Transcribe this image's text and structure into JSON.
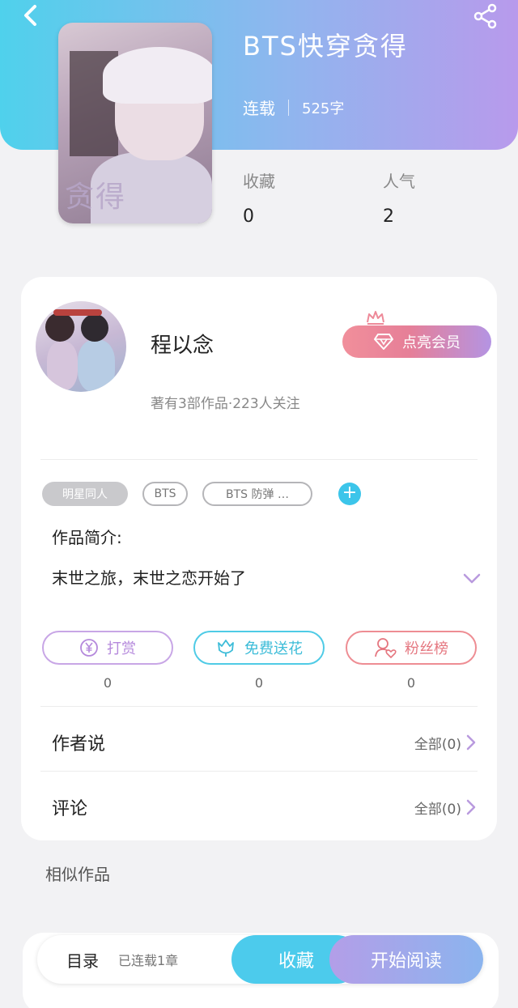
{
  "book": {
    "title": "BTS快穿贪得",
    "status": "连载",
    "words": "525字",
    "cover_text": "贪得",
    "stats": {
      "favorites_label": "收藏",
      "favorites_value": "0",
      "popularity_label": "人气",
      "popularity_value": "2"
    }
  },
  "author": {
    "name": "程以念",
    "meta": "著有3部作品·223人关注",
    "vip_label": "点亮会员"
  },
  "tags": [
    "明星同人",
    "BTS",
    "BTS 防弹 …"
  ],
  "intro": {
    "title": "作品简介:",
    "text": "末世之旅，末世之恋开始了"
  },
  "actions": [
    {
      "label": "打赏",
      "count": "0",
      "icon": "yen-coin-icon"
    },
    {
      "label": "免费送花",
      "count": "0",
      "icon": "flower-icon"
    },
    {
      "label": "粉丝榜",
      "count": "0",
      "icon": "fan-user-icon"
    }
  ],
  "author_say": {
    "label": "作者说",
    "more": "全部(0)"
  },
  "comments": {
    "label": "评论",
    "more": "全部(0)"
  },
  "similar": {
    "title": "相似作品"
  },
  "bottom_bar": {
    "toc_label": "目录",
    "toc_status": "已连载1章",
    "favorite_label": "收藏",
    "read_label": "开始阅读"
  },
  "colors": {
    "header_start": "#4fd1ec",
    "header_end": "#b89aec",
    "accent_cyan": "#4ccbec",
    "accent_purple": "#b494e3",
    "accent_pink": "#e67f98"
  }
}
